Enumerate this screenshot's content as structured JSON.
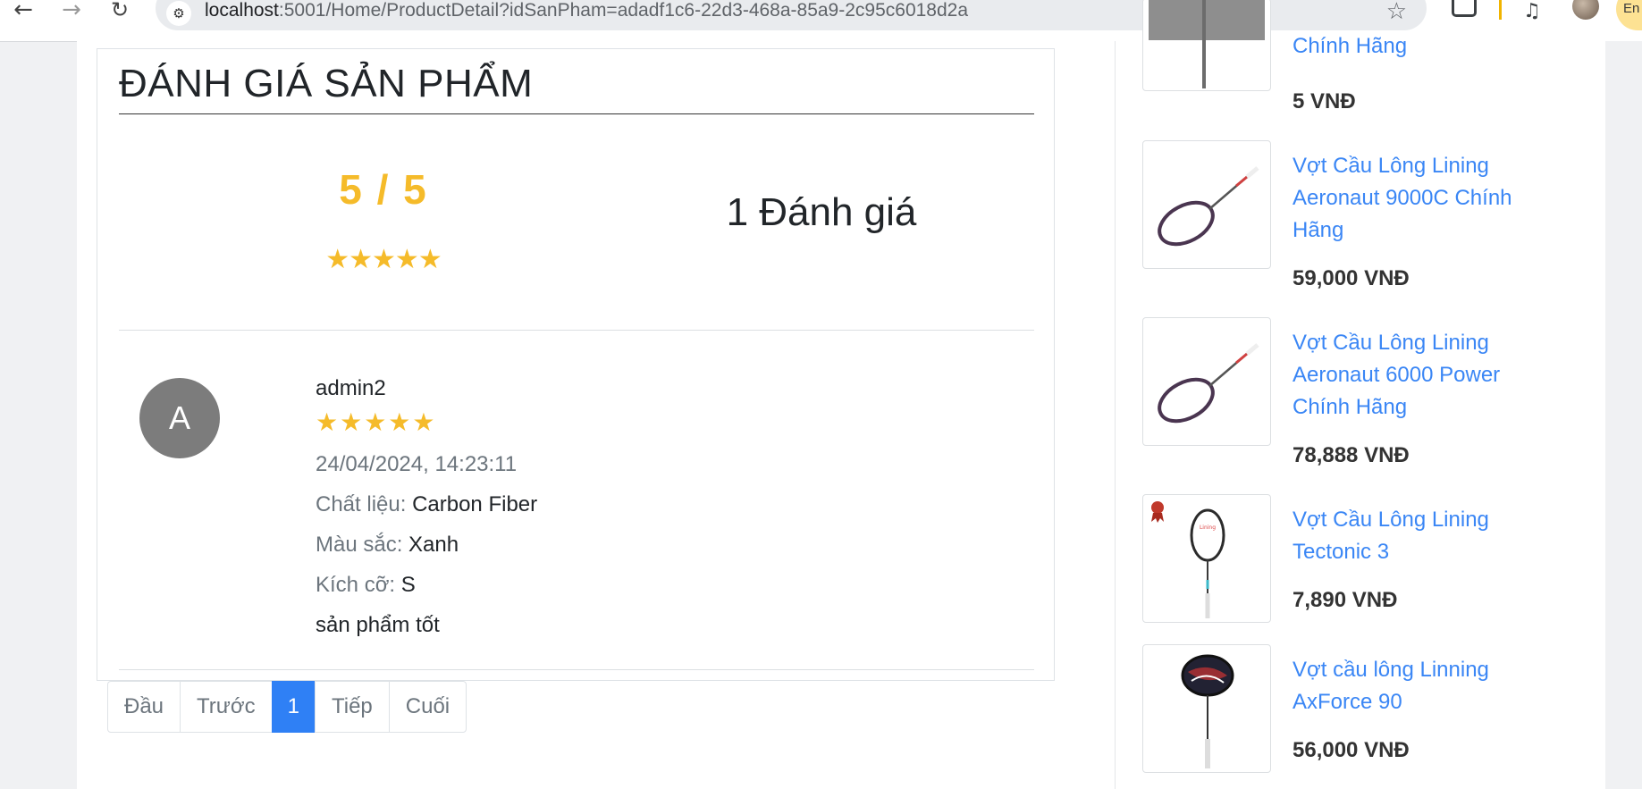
{
  "browser": {
    "url_host": "localhost",
    "url_rest": ":5001/Home/ProductDetail?idSanPham=adadf1c6-22d3-468a-85a9-2c95c6018d2a",
    "profile_label": "En"
  },
  "review_section": {
    "title": "ĐÁNH GIÁ SẢN PHẨM",
    "average": "5 / 5",
    "average_stars": "★★★★★",
    "total_label": "1 Đánh giá",
    "reviews": [
      {
        "avatar_letter": "A",
        "user": "admin2",
        "stars": "★★★★★",
        "datetime": "24/04/2024, 14:23:11",
        "material_label": "Chất liệu:",
        "material_value": "Carbon Fiber",
        "color_label": "Màu sắc:",
        "color_value": "Xanh",
        "size_label": "Kích cỡ:",
        "size_value": "S",
        "comment": "sản phẩm tốt"
      }
    ]
  },
  "pagination": [
    "Đầu",
    "Trước",
    "1",
    "Tiếp",
    "Cuối"
  ],
  "pagination_active": "1",
  "related_products": [
    {
      "name": "Chính Hãng",
      "price": "5 VNĐ"
    },
    {
      "name": "Vợt Cầu Lông Lining Aeronaut 9000C Chính Hãng",
      "price": "59,000 VNĐ"
    },
    {
      "name": "Vợt Cầu Lông Lining Aeronaut 6000 Power Chính Hãng",
      "price": "78,888 VNĐ"
    },
    {
      "name": "Vợt Cầu Lông Lining Tectonic 3",
      "price": "7,890 VNĐ"
    },
    {
      "name": "Vợt cầu lông Linning AxForce 90",
      "price": "56,000 VNĐ"
    }
  ],
  "colors": {
    "star": "#f5bb2a",
    "link": "#3a86f5",
    "active_page": "#2f80f5",
    "avatar": "#7c7c7c"
  }
}
